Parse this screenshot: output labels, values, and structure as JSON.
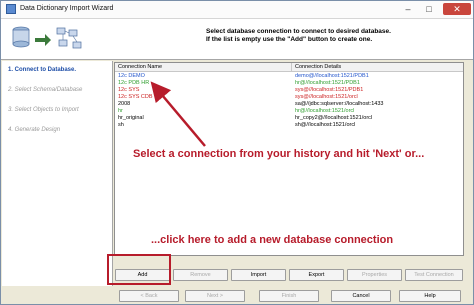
{
  "window": {
    "title": "Data Dictionary Import Wizard",
    "minimize_label": "–",
    "maximize_label": "□",
    "close_label": "✕"
  },
  "header": {
    "instruction_line1": "Select database connection to connect to desired database.",
    "instruction_line2": "If the list is empty use the \"Add\" button to create one."
  },
  "steps": [
    {
      "label": "1. Connect to Database.",
      "active": true
    },
    {
      "label": "2. Select Schema/Database",
      "active": false
    },
    {
      "label": "3. Select Objects to Import",
      "active": false
    },
    {
      "label": "4. Generate Design",
      "active": false
    }
  ],
  "table": {
    "columns": [
      "Connection Name",
      "Connection Details"
    ],
    "rows": [
      {
        "name": "12c DEMO",
        "details": "demo@//localhost:1521/PDB1",
        "color": "#2255cc"
      },
      {
        "name": "12c PDB HR",
        "details": "hr@//localhost:1521/PDB1",
        "color": "#2f9e2f"
      },
      {
        "name": "12c SYS",
        "details": "sys@//localhost:1521/PDB1",
        "color": "#cc2222"
      },
      {
        "name": "12c SYS CDB",
        "details": "sys@//localhost:1521/orcl",
        "color": "#cc2222"
      },
      {
        "name": "2008",
        "details": "sa@//jdbc:sqlserver://localhost:1433",
        "color": "#000000"
      },
      {
        "name": "hr",
        "details": "hr@//localhost:1521/orcl",
        "color": "#2f9e2f"
      },
      {
        "name": "hr_original",
        "details": "hr_copy2@//localhost:1521/orcl",
        "color": "#000000"
      },
      {
        "name": "sh",
        "details": "sh@//localhost:1521/orcl",
        "color": "#000000"
      }
    ]
  },
  "buttons": {
    "add": "Add",
    "remove": "Remove",
    "import": "Import",
    "export": "Export",
    "properties": "Properties",
    "test": "Test Connection"
  },
  "nav": {
    "back": "< Back",
    "next": "Next >",
    "finish": "Finish",
    "cancel": "Cancel",
    "help": "Help"
  },
  "annotations": {
    "top": "Select a connection from your history and hit 'Next' or...",
    "bottom": "...click here to add a new database connection"
  },
  "colors": {
    "annotation": "#b71c2b",
    "active_step": "#1f4fa8"
  }
}
